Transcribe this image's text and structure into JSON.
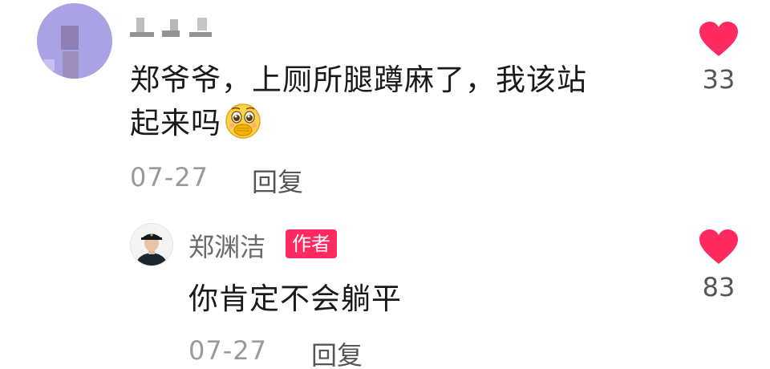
{
  "comment": {
    "username_censored": true,
    "text_line1": "郑爷爷，上厕所腿蹲麻了，我该站",
    "text_line2": "起来吗",
    "emoji": "pleading-hand-over-mouth-emoji",
    "date": "07-27",
    "reply_label": "回复",
    "likes": "33",
    "like_color": "#ff2a5f"
  },
  "reply": {
    "username": "郑渊洁",
    "badge": "作者",
    "badge_color": "#ff2a5f",
    "text": "你肯定不会躺平",
    "date": "07-27",
    "reply_label": "回复",
    "likes": "83",
    "like_color": "#ff2a5f"
  }
}
